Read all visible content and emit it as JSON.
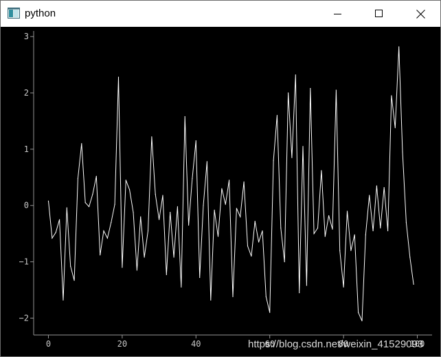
{
  "window": {
    "title": "python",
    "icon": "qt-app-icon",
    "controls": [
      "minimize-icon",
      "maximize-icon",
      "close-icon"
    ]
  },
  "watermark": "https://blog.csdn.net/weixin_41529093",
  "chart_data": {
    "type": "line",
    "background": "#000000",
    "line_color": "#ffffff",
    "axis_color": "#969696",
    "x_ticks": [
      0,
      20,
      40,
      60,
      80,
      100
    ],
    "y_ticks": [
      -2,
      -1,
      0,
      1,
      2,
      3
    ],
    "x_tick_labels": [
      "0",
      "20",
      "40",
      "60",
      "80",
      "100"
    ],
    "y_tick_labels": [
      "−2",
      "−1",
      "0",
      "1",
      "2",
      "3"
    ],
    "xlim": [
      -4,
      104
    ],
    "ylim": [
      -2.3,
      3.1
    ],
    "series": [
      {
        "x": [
          0,
          1,
          2,
          3,
          4,
          5,
          6,
          7,
          8,
          9,
          10,
          11,
          12,
          13,
          14,
          15,
          16,
          17,
          18,
          19,
          20,
          21,
          22,
          23,
          24,
          25,
          26,
          27,
          28,
          29,
          30,
          31,
          32,
          33,
          34,
          35,
          36,
          37,
          38,
          39,
          40,
          41,
          42,
          43,
          44,
          45,
          46,
          47,
          48,
          49,
          50,
          51,
          52,
          53,
          54,
          55,
          56,
          57,
          58,
          59,
          60,
          61,
          62,
          63,
          64,
          65,
          66,
          67,
          68,
          69,
          70,
          71,
          72,
          73,
          74,
          75,
          76,
          77,
          78,
          79,
          80,
          81,
          82,
          83,
          84,
          85,
          86,
          87,
          88,
          89,
          90,
          91,
          92,
          93,
          94,
          95,
          96,
          97,
          98,
          99
        ],
        "y": [
          0.08,
          -0.58,
          -0.48,
          -0.25,
          -1.68,
          -0.04,
          -1.08,
          -1.33,
          0.48,
          1.1,
          0.05,
          -0.02,
          0.2,
          0.52,
          -0.88,
          -0.45,
          -0.58,
          -0.3,
          0.02,
          2.28,
          -1.1,
          0.45,
          0.28,
          -0.12,
          -1.15,
          -0.2,
          -0.92,
          -0.45,
          1.22,
          0.2,
          -0.25,
          0.18,
          -1.23,
          -0.12,
          -0.92,
          -0.02,
          -1.45,
          1.58,
          -0.35,
          0.48,
          1.15,
          -1.28,
          0.0,
          0.78,
          -1.68,
          -0.08,
          -0.55,
          0.3,
          0.02,
          0.45,
          -1.62,
          -0.05,
          -0.2,
          0.42,
          -0.72,
          -0.9,
          -0.28,
          -0.65,
          -0.45,
          -1.62,
          -1.9,
          0.8,
          1.6,
          -0.4,
          -1.0,
          2.0,
          0.85,
          2.32,
          -1.55,
          1.05,
          -1.42,
          2.08,
          -0.5,
          -0.4,
          0.62,
          -0.55,
          -0.18,
          -0.42,
          2.05,
          -0.8,
          -1.45,
          -0.1,
          -0.8,
          -0.52,
          -1.9,
          -2.05,
          -0.52,
          0.18,
          -0.45,
          0.35,
          -0.4,
          0.32,
          -0.45,
          1.95,
          1.38,
          2.82,
          0.95,
          -0.3,
          -0.92,
          -1.4
        ]
      }
    ]
  }
}
